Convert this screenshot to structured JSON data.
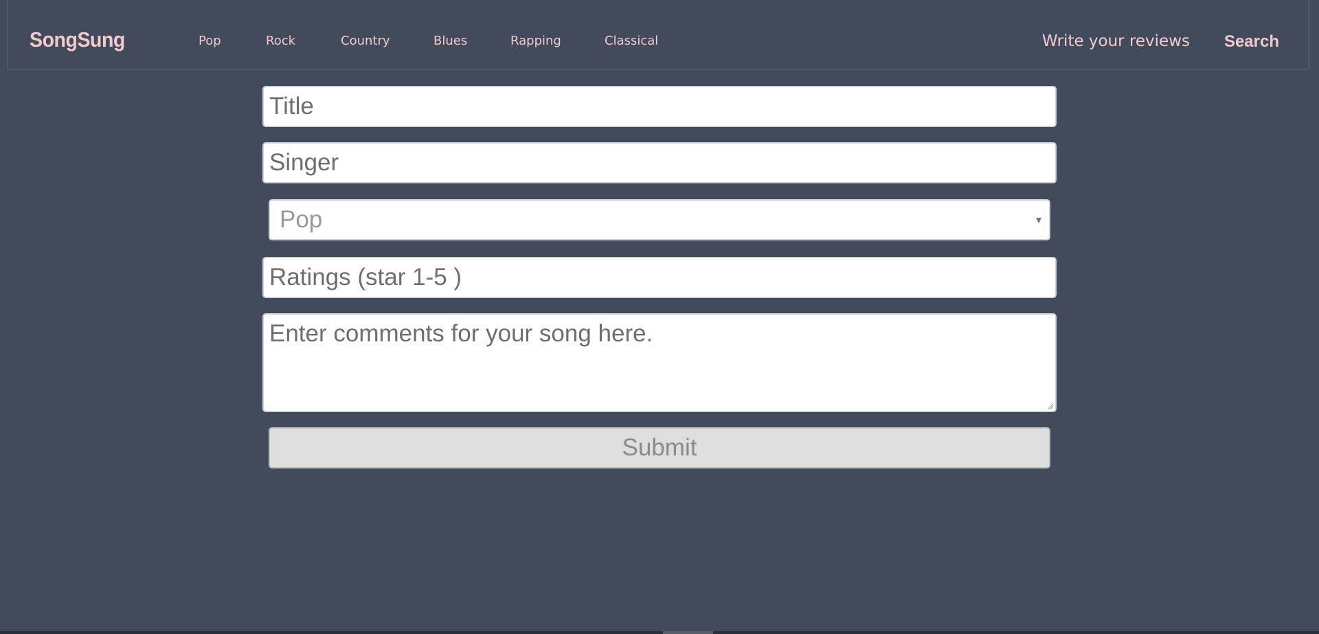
{
  "navbar": {
    "brand": "SongSung",
    "genres": [
      "Pop",
      "Rock",
      "Country",
      "Blues",
      "Rapping",
      "Classical"
    ],
    "write_reviews": "Write your reviews",
    "search": "Search"
  },
  "form": {
    "title_placeholder": "Title",
    "singer_placeholder": "Singer",
    "genre_selected": "Pop",
    "ratings_placeholder": "Ratings (star 1-5 )",
    "comments_placeholder": "Enter comments for your song here.",
    "submit_label": "Submit"
  },
  "icons": {
    "select_arrow": "chevron-down-icon",
    "resize_grip": "resize-grip-icon"
  },
  "colors": {
    "background": "#424b5b",
    "accent_text": "#f2c9cc",
    "field_background": "#ffffff",
    "submit_background": "#dedede"
  }
}
